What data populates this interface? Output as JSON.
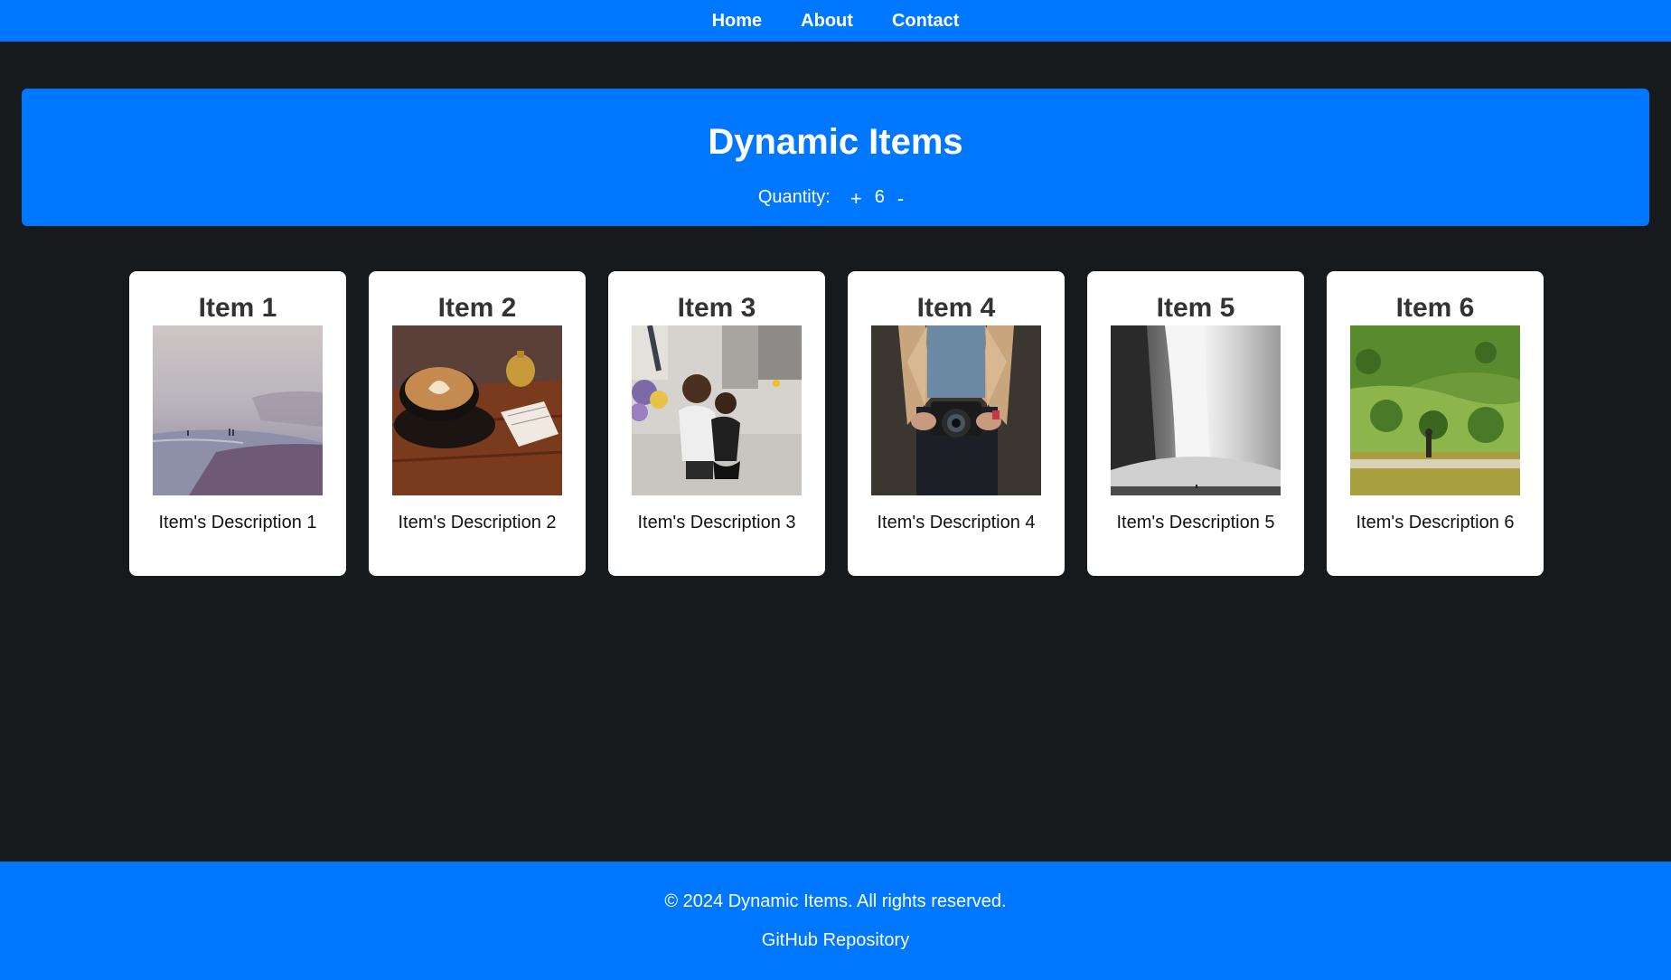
{
  "nav": {
    "items": [
      {
        "label": "Home"
      },
      {
        "label": "About"
      },
      {
        "label": "Contact"
      }
    ]
  },
  "hero": {
    "title": "Dynamic Items",
    "quantity_label": "Quantity:",
    "increment_label": "+",
    "quantity_value": "6",
    "decrement_label": "-"
  },
  "items": [
    {
      "title": "Item 1",
      "description": "Item's Description 1",
      "image": "misty-beach-photo"
    },
    {
      "title": "Item 2",
      "description": "Item's Description 2",
      "image": "latte-on-wooden-table-photo"
    },
    {
      "title": "Item 3",
      "description": "Item's Description 3",
      "image": "mother-and-child-city-street-photo"
    },
    {
      "title": "Item 4",
      "description": "Item's Description 4",
      "image": "person-holding-camera-photo"
    },
    {
      "title": "Item 5",
      "description": "Item's Description 5",
      "image": "waterfall-photo"
    },
    {
      "title": "Item 6",
      "description": "Item's Description 6",
      "image": "green-hills-with-sheep-photo"
    }
  ],
  "footer": {
    "copyright": "© 2024 Dynamic Items. All rights reserved.",
    "github_label": "GitHub Repository"
  },
  "colors": {
    "brand_blue": "#0077ff",
    "page_background": "#171a1c",
    "card_background": "#ffffff"
  }
}
